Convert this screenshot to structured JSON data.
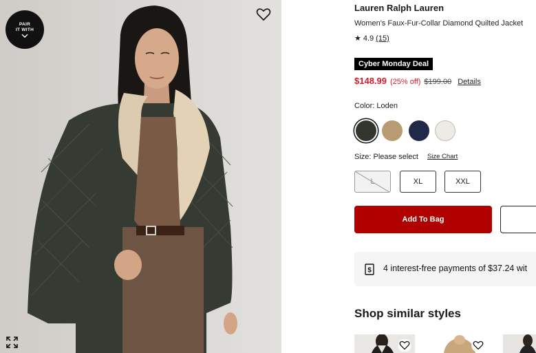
{
  "product": {
    "brand": "Lauren Ralph Lauren",
    "name": "Women's Faux-Fur-Collar Diamond Quilted Jacket",
    "rating_value": "4.9",
    "rating_count": "(15)",
    "deal_badge": "Cyber Monday Deal",
    "price": "$148.99",
    "discount": "(25% off)",
    "original_price": "$199.00",
    "details_link": "Details"
  },
  "image": {
    "pair_badge_line1": "PAIR",
    "pair_badge_line2": "IT WITH",
    "icons": [
      "heart-icon",
      "expand-icon",
      "chevron-down-icon"
    ]
  },
  "color": {
    "label": "Color: Loden",
    "swatches": [
      {
        "name": "Loden",
        "hex": "#30352e",
        "selected": true
      },
      {
        "name": "Camel",
        "hex": "#b89b72",
        "selected": false
      },
      {
        "name": "Navy",
        "hex": "#202a48",
        "selected": false
      },
      {
        "name": "Cream",
        "hex": "#eeebe3",
        "selected": false
      }
    ]
  },
  "size": {
    "label": "Size: Please select",
    "chart_link": "Size Chart",
    "options": [
      {
        "label": "L",
        "available": false
      },
      {
        "label": "XL",
        "available": true
      },
      {
        "label": "XXL",
        "available": true
      }
    ]
  },
  "actions": {
    "add_to_bag": "Add To Bag"
  },
  "payment": {
    "text": "4 interest-free payments of $37.24 wit"
  },
  "similar": {
    "title": "Shop similar styles"
  },
  "colors": {
    "price_red": "#d41b2c",
    "bag_button": "#b00000",
    "badge_black": "#000000"
  }
}
